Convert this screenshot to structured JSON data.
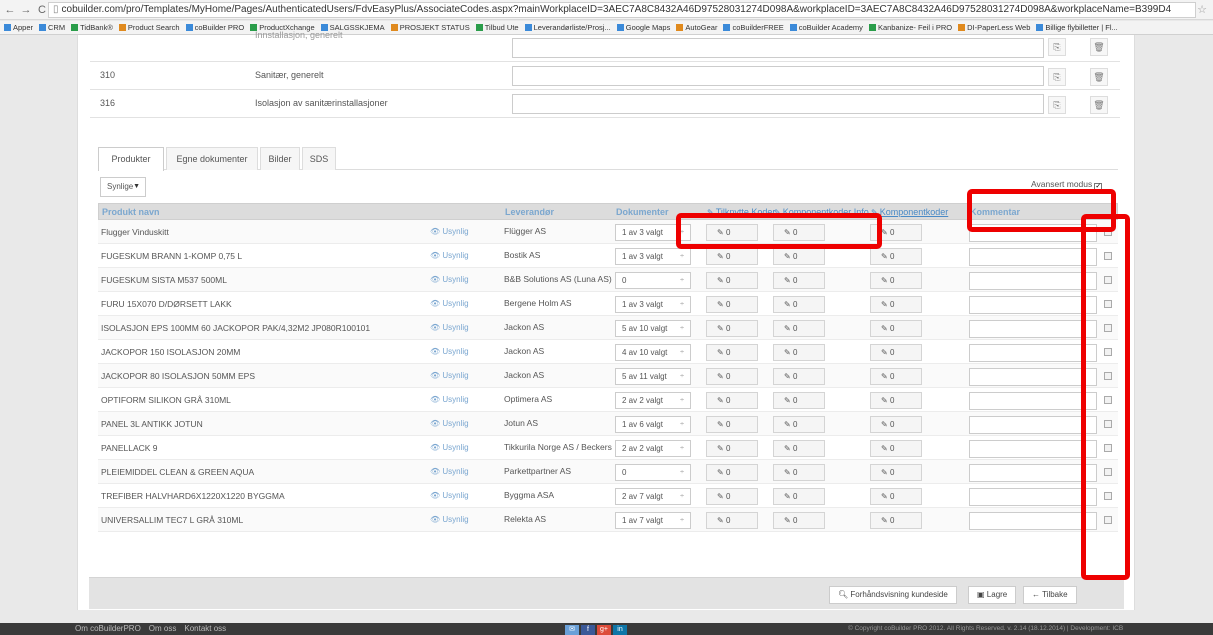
{
  "browser": {
    "url": "cobuilder.com/pro/Templates/MyHome/Pages/AuthenticatedUsers/FdvEasyPlus/AssociateCodes.aspx?mainWorkplaceID=3AEC7A8C8432A46D97528031274D098A&workplaceID=3AEC7A8C8432A46D97528031274D098A&workplaceName=B399D4",
    "bookmarks": [
      "Apper",
      "CRM",
      "TidBank®",
      "Product Search",
      "coBuilder PRO",
      "ProductXchange",
      "SALGSSKJEMA",
      "PROSJEKT STATUS",
      "Tilbud Ute",
      "Leverandørliste/Prosj...",
      "Google Maps",
      "AutoGear",
      "coBuilderFREE",
      "coBuilder Academy",
      "Kanbanize- Feil i PRO",
      "DI-PaperLess Web",
      "Billige flybilletter | Fl..."
    ]
  },
  "code_rows": [
    {
      "code": "",
      "desc": "Innstallasjon, generelt"
    },
    {
      "code": "310",
      "desc": "Sanitær, generelt"
    },
    {
      "code": "316",
      "desc": "Isolasjon av sanitærinstallasjoner"
    }
  ],
  "tabs": [
    "Produkter",
    "Egne dokumenter",
    "Bilder",
    "SDS"
  ],
  "filter_value": "Synlige",
  "advanced_mode_label": "Avansert modus",
  "grid_headers": {
    "name": "Produkt navn",
    "supplier": "Leverandør",
    "documents": "Dokumenter",
    "col_a": "Tilknytte Koder",
    "col_b": "Komponentkoder Info",
    "col_c": "Komponentkoder",
    "comment": "Kommentar"
  },
  "visibility_label": "Usynlig",
  "pencil_value": "0",
  "products": [
    {
      "name": "Flugger Vinduskitt",
      "supplier": "Flügger AS",
      "docs": "1 av 3 valgt"
    },
    {
      "name": "FUGESKUM BRANN 1-KOMP 0,75 L",
      "supplier": "Bostik AS",
      "docs": "1 av 3 valgt"
    },
    {
      "name": "FUGESKUM SISTA M537 500ML",
      "supplier": "B&B Solutions AS (Luna AS)",
      "docs": "0"
    },
    {
      "name": "FURU 15X070 D/DØRSETT LAKK",
      "supplier": "Bergene Holm AS",
      "docs": "1 av 3 valgt"
    },
    {
      "name": "ISOLASJON EPS 100MM 60 JACKOPOR PAK/4,32M2 JP080R100101",
      "supplier": "Jackon AS",
      "docs": "5 av 10 valgt"
    },
    {
      "name": "JACKOPOR 150 ISOLASJON 20MM",
      "supplier": "Jackon AS",
      "docs": "4 av 10 valgt"
    },
    {
      "name": "JACKOPOR 80 ISOLASJON 50MM EPS",
      "supplier": "Jackon AS",
      "docs": "5 av 11 valgt"
    },
    {
      "name": "OPTIFORM SILIKON GRÅ 310ML",
      "supplier": "Optimera AS",
      "docs": "2 av 2 valgt"
    },
    {
      "name": "PANEL 3L ANTIKK JOTUN",
      "supplier": "Jotun AS",
      "docs": "1 av 6 valgt"
    },
    {
      "name": "PANELLACK 9",
      "supplier": "Tikkurila Norge AS / Beckers",
      "docs": "2 av 2 valgt"
    },
    {
      "name": "PLEIEMIDDEL CLEAN & GREEN AQUA",
      "supplier": "Parkettpartner AS",
      "docs": "0"
    },
    {
      "name": "TREFIBER HALVHARD6X1220X1220 BYGGMA",
      "supplier": "Byggma ASA",
      "docs": "2 av 7 valgt"
    },
    {
      "name": "UNIVERSALLIM TEC7 L GRÅ 310ML",
      "supplier": "Relekta AS",
      "docs": "1 av 7 valgt"
    }
  ],
  "toolbar": {
    "preview": "Forhåndsvisning kundeside",
    "save": "Lagre",
    "back": "Tilbake"
  },
  "footer": {
    "links": [
      "Om coBuilderPRO",
      "Om oss",
      "Kontakt oss"
    ],
    "copyright": "© Copyright coBuilder PRO 2012. All Rights Reserved. v. 2.14 (18.12.2014) | Development: ICB"
  },
  "colors": {
    "highlight": "#ee0000",
    "link": "#4a8ac6",
    "header_bg": "#dcdcdc"
  }
}
